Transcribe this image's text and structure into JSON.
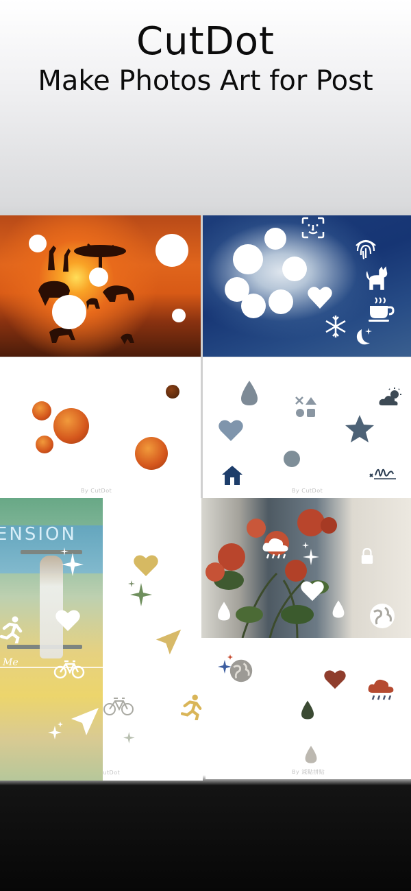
{
  "header": {
    "app_name": "CutDot",
    "tagline": "Make Photos Art for Post"
  },
  "cards": {
    "savanna_caption": "By CutDot",
    "icons_caption": "By CutDot",
    "mid_caption": "By CutDot",
    "flower_caption": "By 減點拼貼"
  },
  "poster_word": "ENSION",
  "poster_script": "Me",
  "icons": [
    "face-id-icon",
    "fingerprint-icon",
    "cat-icon",
    "coffee-icon",
    "snowflake-icon",
    "moon-stars-icon",
    "heart-icon",
    "drop-icon",
    "shapes-icon",
    "cloud-sun-icon",
    "star-icon",
    "home-icon",
    "signature-icon",
    "sparkles-icon",
    "send-icon",
    "runner-icon",
    "bicycle-icon",
    "lock-icon",
    "cloud-rain-icon",
    "globe-icon"
  ],
  "colors": {
    "title": "#0c0c0c",
    "savanna_orange": "#e0651c",
    "night_blue": "#163574",
    "gold": "#d7b968",
    "white": "#ffffff"
  }
}
